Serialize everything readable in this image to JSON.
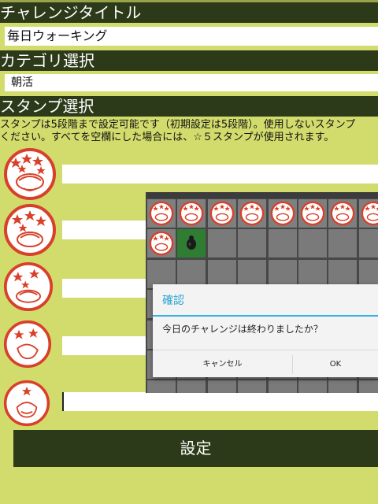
{
  "form": {
    "title_header": "チャレンジタイトル",
    "title_value": "毎日ウォーキング",
    "category_header": "カテゴリ選択",
    "category_value": "朝活",
    "stamp_header": "スタンプ選択",
    "stamp_desc_line1": "スタンプは5段階まで設定可能です（初期設定は5段階）。使用しないスタンプ",
    "stamp_desc_line2": "ください。すべてを空欄にした場合には、☆５スタンプが使用されます。",
    "submit_label": "設定"
  },
  "stamps": [
    {
      "stars": 5,
      "value": ""
    },
    {
      "stars": 4,
      "value": ""
    },
    {
      "stars": 3,
      "value": ""
    },
    {
      "stars": 2,
      "value": ""
    },
    {
      "stars": 1,
      "value": ""
    }
  ],
  "dialog": {
    "title": "確認",
    "message": "今日のチャレンジは終わりましたか？",
    "cancel_label": "キャンセル",
    "ok_label": "OK"
  },
  "colors": {
    "background": "#d2dc6d",
    "header": "#2c3a19",
    "stamp_red": "#d8402a",
    "dialog_accent": "#36b2e0"
  }
}
